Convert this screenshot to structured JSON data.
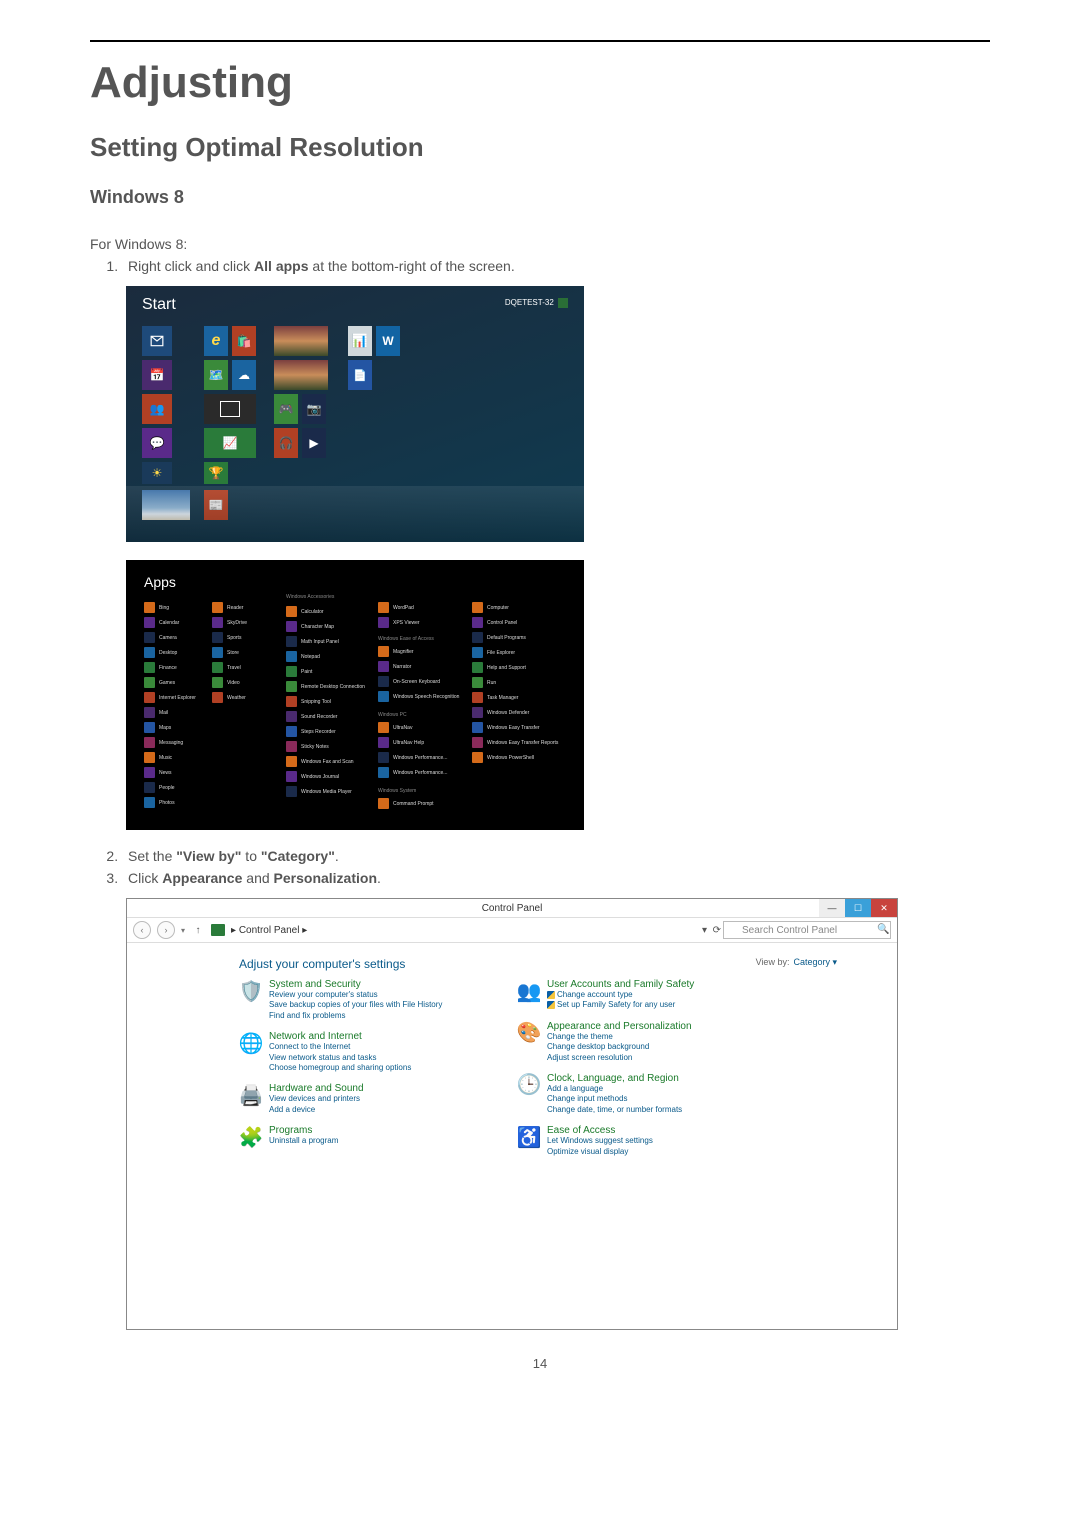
{
  "doc": {
    "h1": "Adjusting",
    "h2": "Setting Optimal Resolution",
    "h3": "Windows 8",
    "intro": "For Windows 8:",
    "step1_pre": "Right click and click ",
    "step1_bold": "All apps",
    "step1_post": " at the bottom-right of the screen.",
    "step2_pre": "Set the ",
    "step2_b1": "\"View by\"",
    "step2_mid": " to ",
    "step2_b2": "\"Category\"",
    "step2_post": ".",
    "step3_pre": "Click ",
    "step3_b1": "Appearance",
    "step3_mid": " and ",
    "step3_b2": "Personalization",
    "step3_post": ".",
    "page_number": "14"
  },
  "start": {
    "title": "Start",
    "user": "DQETEST-32",
    "labels": {
      "mail": "Mail",
      "calendar": "Calendar",
      "people": "People",
      "messaging": "Messaging",
      "store": "Store",
      "ie": "Internet Explorer",
      "photos": "Photos",
      "video": "Video",
      "music": "Music",
      "weather": "Weather",
      "skydrive": "SkyDrive",
      "desktop": "Desktop"
    }
  },
  "apps": {
    "title": "Apps",
    "col1": [
      "Bing",
      "Calendar",
      "Camera",
      "Desktop",
      "Finance",
      "Games",
      "Internet Explorer",
      "Mail",
      "Maps",
      "Messaging",
      "Music",
      "News",
      "People",
      "Photos"
    ],
    "col2": [
      "Reader",
      "SkyDrive",
      "Sports",
      "Store",
      "Travel",
      "Video",
      "Weather"
    ],
    "col3_head": "Windows Accessories",
    "col3": [
      "Calculator",
      "Character Map",
      "Math Input Panel",
      "Notepad",
      "Paint",
      "Remote Desktop Connection",
      "Snipping Tool",
      "Sound Recorder",
      "Steps Recorder",
      "Sticky Notes",
      "Windows Fax and Scan",
      "Windows Journal",
      "Windows Media Player"
    ],
    "col4": [
      "WordPad",
      "XPS Viewer"
    ],
    "col4_head": "Windows Ease of Access",
    "col4b": [
      "Magnifier",
      "Narrator",
      "On-Screen Keyboard",
      "Windows Speech Recognition"
    ],
    "col4_head2": "Windows PC",
    "col4c": [
      "UltraNav",
      "UltraNav Help",
      "Windows Performance...",
      "Windows Performance..."
    ],
    "col4_head3": "Windows System",
    "col4d": [
      "Command Prompt"
    ],
    "col5": [
      "Computer",
      "Control Panel",
      "Default Programs",
      "File Explorer",
      "Help and Support",
      "Run",
      "Task Manager",
      "Windows Defender",
      "Windows Easy Transfer",
      "Windows Easy Transfer Reports",
      "Windows PowerShell"
    ]
  },
  "cp": {
    "title": "Control Panel",
    "crumb": "Control Panel",
    "search_placeholder": "Search Control Panel",
    "adjust": "Adjust your computer's settings",
    "viewby_label": "View by:",
    "viewby_value": "Category ▾",
    "left": [
      {
        "title": "System and Security",
        "subs": [
          "Review your computer's status",
          "Save backup copies of your files with File History",
          "Find and fix problems"
        ],
        "icon": "🛡️"
      },
      {
        "title": "Network and Internet",
        "subs": [
          "Connect to the Internet",
          "View network status and tasks",
          "Choose homegroup and sharing options"
        ],
        "icon": "🌐"
      },
      {
        "title": "Hardware and Sound",
        "subs": [
          "View devices and printers",
          "Add a device"
        ],
        "icon": "🖨️"
      },
      {
        "title": "Programs",
        "subs": [
          "Uninstall a program"
        ],
        "icon": "🧩"
      }
    ],
    "right": [
      {
        "title": "User Accounts and Family Safety",
        "subs": [
          "Change account type",
          "Set up Family Safety for any user"
        ],
        "icon": "👥",
        "shielded": [
          0,
          1
        ]
      },
      {
        "title": "Appearance and Personalization",
        "subs": [
          "Change the theme",
          "Change desktop background",
          "Adjust screen resolution"
        ],
        "icon": "🎨"
      },
      {
        "title": "Clock, Language, and Region",
        "subs": [
          "Add a language",
          "Change input methods",
          "Change date, time, or number formats"
        ],
        "icon": "🕒"
      },
      {
        "title": "Ease of Access",
        "subs": [
          "Let Windows suggest settings",
          "Optimize visual display"
        ],
        "icon": "♿"
      }
    ]
  }
}
